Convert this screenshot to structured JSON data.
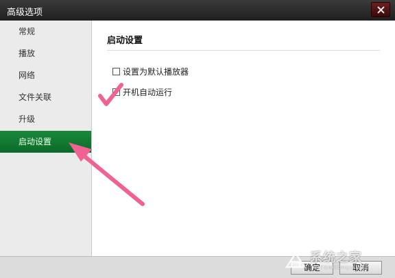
{
  "window": {
    "title": "高级选项",
    "close_icon": "close-icon"
  },
  "sidebar": {
    "items": [
      {
        "label": "常规"
      },
      {
        "label": "播放"
      },
      {
        "label": "网络"
      },
      {
        "label": "文件关联"
      },
      {
        "label": "升级"
      },
      {
        "label": "启动设置",
        "active": true
      }
    ]
  },
  "content": {
    "section_title": "启动设置",
    "options": [
      {
        "label": "设置为默认播放器",
        "checked": false
      },
      {
        "label": "开机自动运行",
        "checked": false
      }
    ]
  },
  "footer": {
    "ok_label": "确定",
    "cancel_label": "取消"
  },
  "watermark": {
    "text": "系统之家",
    "subtext": "XITONGZHIJIA.NET"
  },
  "annotation_color": "#f06292",
  "accent_color": "#0e7a32"
}
